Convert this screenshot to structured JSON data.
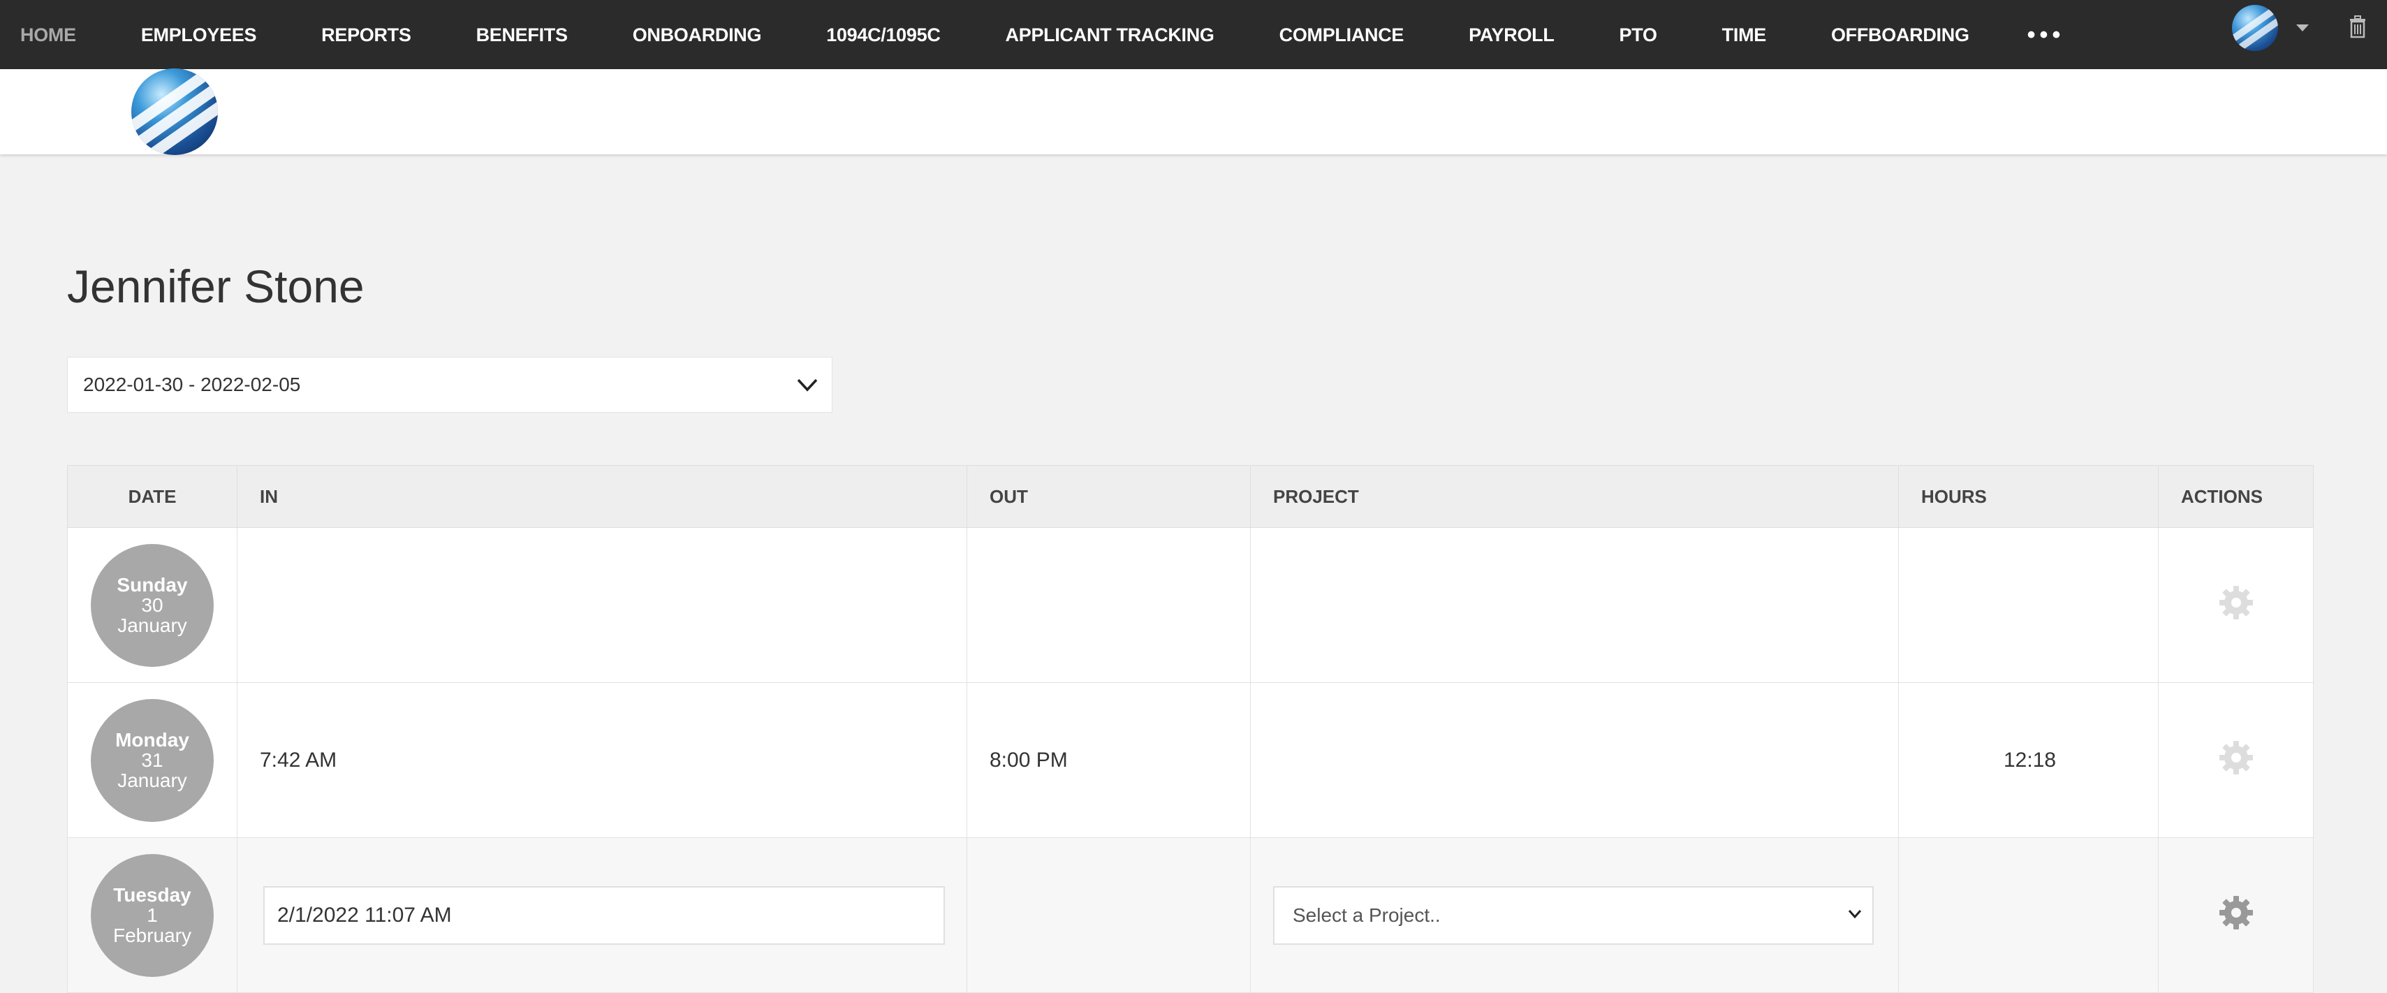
{
  "nav": {
    "items": [
      {
        "label": "HOME",
        "muted": true
      },
      {
        "label": "EMPLOYEES"
      },
      {
        "label": "REPORTS"
      },
      {
        "label": "BENEFITS"
      },
      {
        "label": "ONBOARDING"
      },
      {
        "label": "1094C/1095C"
      },
      {
        "label": "APPLICANT TRACKING"
      },
      {
        "label": "COMPLIANCE"
      },
      {
        "label": "PAYROLL"
      },
      {
        "label": "PTO"
      },
      {
        "label": "TIME"
      },
      {
        "label": "OFFBOARDING"
      }
    ],
    "more_label": "•••"
  },
  "page": {
    "title": "Jennifer Stone",
    "week_range": "2022-01-30 - 2022-02-05"
  },
  "table": {
    "headers": {
      "date": "DATE",
      "in": "IN",
      "out": "OUT",
      "project": "PROJECT",
      "hours": "HOURS",
      "actions": "ACTIONS"
    },
    "rows": [
      {
        "dow": "Sunday",
        "day": "30",
        "month": "January",
        "in": "",
        "out": "",
        "project": "",
        "hours": ""
      },
      {
        "dow": "Monday",
        "day": "31",
        "month": "January",
        "in": "7:42 AM",
        "out": "8:00 PM",
        "project": "",
        "hours": "12:18"
      },
      {
        "dow": "Tuesday",
        "day": "1",
        "month": "February",
        "in_value": "2/1/2022 11:07 AM",
        "out": "",
        "project_placeholder": "Select a Project..",
        "hours": ""
      }
    ]
  },
  "colors": {
    "nav_bg": "#2b2b2b",
    "date_circle": "#a8a8a8",
    "gear_inactive": "#dddddd",
    "gear_active": "#999999"
  }
}
